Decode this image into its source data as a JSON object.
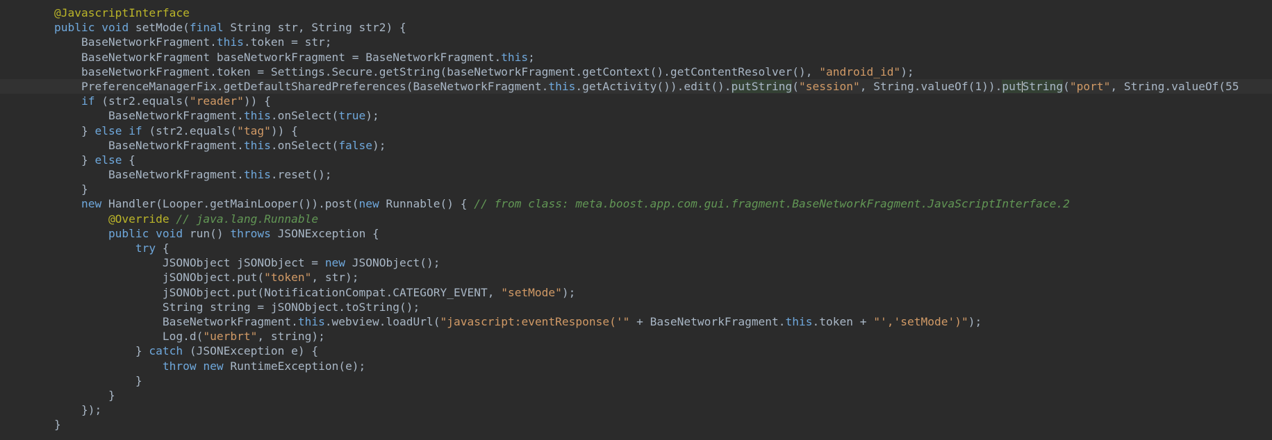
{
  "editor": {
    "indent_unit": "    ",
    "base_indent": "        ",
    "cursor_line": 5,
    "lines": [
      {
        "tokens": [
          {
            "t": "@JavascriptInterface",
            "c": "ann"
          }
        ]
      },
      {
        "tokens": [
          {
            "t": "public",
            "c": "kw"
          },
          {
            "t": " "
          },
          {
            "t": "void",
            "c": "kw"
          },
          {
            "t": " setMode("
          },
          {
            "t": "final",
            "c": "kw"
          },
          {
            "t": " String str, String str2) {"
          }
        ]
      },
      {
        "indent": 1,
        "tokens": [
          {
            "t": "BaseNetworkFragment."
          },
          {
            "t": "this",
            "c": "kw"
          },
          {
            "t": ".token = str;"
          }
        ]
      },
      {
        "indent": 1,
        "tokens": [
          {
            "t": "BaseNetworkFragment baseNetworkFragment = BaseNetworkFragment."
          },
          {
            "t": "this",
            "c": "kw"
          },
          {
            "t": ";"
          }
        ]
      },
      {
        "indent": 1,
        "tokens": [
          {
            "t": "baseNetworkFragment.token = Settings.Secure.getString(baseNetworkFragment.getContext().getContentResolver(), "
          },
          {
            "t": "\"android_id\"",
            "c": "str"
          },
          {
            "t": ");"
          }
        ]
      },
      {
        "indent": 1,
        "tokens": [
          {
            "t": "PreferenceManagerFix.getDefaultSharedPreferences(BaseNetworkFragment."
          },
          {
            "t": "this",
            "c": "kw"
          },
          {
            "t": ".getActivity()).edit()."
          },
          {
            "t": "putString",
            "c": "hl"
          },
          {
            "t": "("
          },
          {
            "t": "\"session\"",
            "c": "str"
          },
          {
            "t": ", String.valueOf(1))."
          },
          {
            "t": "put",
            "c": "hl"
          },
          {
            "t": "",
            "c": "caret"
          },
          {
            "t": "String",
            "c": "hl"
          },
          {
            "t": "("
          },
          {
            "t": "\"port\"",
            "c": "str"
          },
          {
            "t": ", String.valueOf(55"
          }
        ]
      },
      {
        "indent": 1,
        "tokens": [
          {
            "t": "if",
            "c": "kw"
          },
          {
            "t": " (str2.equals("
          },
          {
            "t": "\"reader\"",
            "c": "str"
          },
          {
            "t": ")) {"
          }
        ]
      },
      {
        "indent": 2,
        "tokens": [
          {
            "t": "BaseNetworkFragment."
          },
          {
            "t": "this",
            "c": "kw"
          },
          {
            "t": ".onSelect("
          },
          {
            "t": "true",
            "c": "kw"
          },
          {
            "t": ");"
          }
        ]
      },
      {
        "indent": 1,
        "tokens": [
          {
            "t": "} "
          },
          {
            "t": "else",
            "c": "kw"
          },
          {
            "t": " "
          },
          {
            "t": "if",
            "c": "kw"
          },
          {
            "t": " (str2.equals("
          },
          {
            "t": "\"tag\"",
            "c": "str"
          },
          {
            "t": ")) {"
          }
        ]
      },
      {
        "indent": 2,
        "tokens": [
          {
            "t": "BaseNetworkFragment."
          },
          {
            "t": "this",
            "c": "kw"
          },
          {
            "t": ".onSelect("
          },
          {
            "t": "false",
            "c": "kw"
          },
          {
            "t": ");"
          }
        ]
      },
      {
        "indent": 1,
        "tokens": [
          {
            "t": "} "
          },
          {
            "t": "else",
            "c": "kw"
          },
          {
            "t": " {"
          }
        ]
      },
      {
        "indent": 2,
        "tokens": [
          {
            "t": "BaseNetworkFragment."
          },
          {
            "t": "this",
            "c": "kw"
          },
          {
            "t": ".reset();"
          }
        ]
      },
      {
        "indent": 1,
        "tokens": [
          {
            "t": "}"
          }
        ]
      },
      {
        "indent": 1,
        "tokens": [
          {
            "t": "new",
            "c": "kw"
          },
          {
            "t": " Handler(Looper.getMainLooper()).post("
          },
          {
            "t": "new",
            "c": "kw"
          },
          {
            "t": " Runnable() { "
          },
          {
            "t": "// from class: meta.boost.app.com.gui.fragment.BaseNetworkFragment.JavaScriptInterface.2",
            "c": "cmt"
          }
        ]
      },
      {
        "indent": 2,
        "tokens": [
          {
            "t": "@Override",
            "c": "ann"
          },
          {
            "t": " "
          },
          {
            "t": "// java.lang.Runnable",
            "c": "cmt"
          }
        ]
      },
      {
        "indent": 2,
        "tokens": [
          {
            "t": "public",
            "c": "kw"
          },
          {
            "t": " "
          },
          {
            "t": "void",
            "c": "kw"
          },
          {
            "t": " run() "
          },
          {
            "t": "throws",
            "c": "kw"
          },
          {
            "t": " JSONException {"
          }
        ]
      },
      {
        "indent": 3,
        "tokens": [
          {
            "t": "try",
            "c": "kw"
          },
          {
            "t": " {"
          }
        ]
      },
      {
        "indent": 4,
        "tokens": [
          {
            "t": "JSONObject jSONObject = "
          },
          {
            "t": "new",
            "c": "kw"
          },
          {
            "t": " JSONObject();"
          }
        ]
      },
      {
        "indent": 4,
        "tokens": [
          {
            "t": "jSONObject.put("
          },
          {
            "t": "\"token\"",
            "c": "str"
          },
          {
            "t": ", str);"
          }
        ]
      },
      {
        "indent": 4,
        "tokens": [
          {
            "t": "jSONObject.put(NotificationCompat.CATEGORY_EVENT, "
          },
          {
            "t": "\"setMode\"",
            "c": "str"
          },
          {
            "t": ");"
          }
        ]
      },
      {
        "indent": 4,
        "tokens": [
          {
            "t": "String string = jSONObject.toString();"
          }
        ]
      },
      {
        "indent": 4,
        "tokens": [
          {
            "t": "BaseNetworkFragment."
          },
          {
            "t": "this",
            "c": "kw"
          },
          {
            "t": ".webview.loadUrl("
          },
          {
            "t": "\"javascript:eventResponse('\"",
            "c": "str"
          },
          {
            "t": " + BaseNetworkFragment."
          },
          {
            "t": "this",
            "c": "kw"
          },
          {
            "t": ".token + "
          },
          {
            "t": "\"','setMode')\"",
            "c": "str"
          },
          {
            "t": ");"
          }
        ]
      },
      {
        "indent": 4,
        "tokens": [
          {
            "t": "Log.d("
          },
          {
            "t": "\"uerbrt\"",
            "c": "str"
          },
          {
            "t": ", string);"
          }
        ]
      },
      {
        "indent": 3,
        "tokens": [
          {
            "t": "} "
          },
          {
            "t": "catch",
            "c": "kw"
          },
          {
            "t": " (JSONException e) {"
          }
        ]
      },
      {
        "indent": 4,
        "tokens": [
          {
            "t": "throw",
            "c": "kw"
          },
          {
            "t": " "
          },
          {
            "t": "new",
            "c": "kw"
          },
          {
            "t": " RuntimeException(e);"
          }
        ]
      },
      {
        "indent": 3,
        "tokens": [
          {
            "t": "}"
          }
        ]
      },
      {
        "indent": 2,
        "tokens": [
          {
            "t": "}"
          }
        ]
      },
      {
        "indent": 1,
        "tokens": [
          {
            "t": "});"
          }
        ]
      },
      {
        "tokens": [
          {
            "t": "}"
          }
        ]
      }
    ]
  }
}
